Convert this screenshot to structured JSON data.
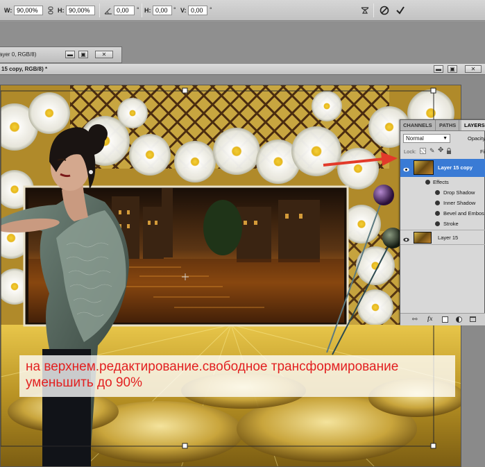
{
  "options_bar": {
    "w_label": "W:",
    "w_value": "90,00%",
    "h_label": "H:",
    "h_value": "90,00%",
    "angle_value": "0,00",
    "degree": "°",
    "skew_h_label": "H:",
    "skew_h_value": "0,00",
    "skew_v_label": "V:",
    "skew_v_value": "0,00"
  },
  "back_window": {
    "title": "ayer 0, RGB/8)"
  },
  "front_window": {
    "title": "15 copy, RGB/8) *"
  },
  "layers_panel": {
    "tabs": [
      "CHANNELS",
      "PATHS",
      "LAYERS"
    ],
    "blend_mode": "Normal",
    "opacity_label": "Opacity",
    "lock_label": "Lock:",
    "fill_label": "Fi",
    "layers": [
      {
        "name": "Layer 15 copy",
        "selected": true
      },
      {
        "name": "Layer 15",
        "selected": false
      }
    ],
    "effects_label": "Effects",
    "effects": [
      "Drop Shadow",
      "Inner Shadow",
      "Bevel and Embos",
      "Stroke"
    ]
  },
  "caption": {
    "line1": "на верхнем.редактирование.свободное трансформирование",
    "line2": "уменьшить до 90%"
  },
  "colors": {
    "caption_text": "#e22020",
    "selected_layer": "#3a7bd5",
    "arrow": "#e23a2a"
  }
}
